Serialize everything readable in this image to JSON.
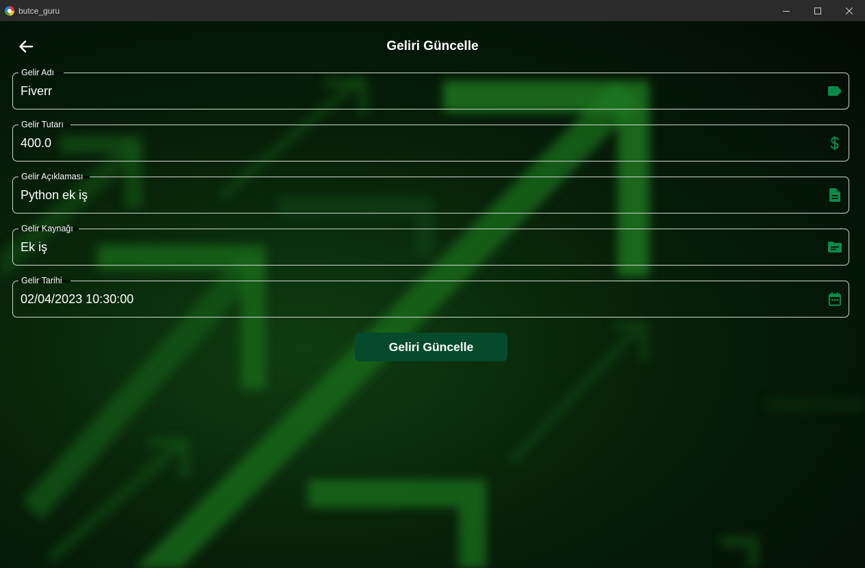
{
  "window": {
    "title": "butce_guru",
    "controls": [
      "minimize-icon",
      "maximize-icon",
      "close-icon"
    ]
  },
  "header": {
    "back_icon": "arrow-left-icon",
    "title": "Geliri Güncelle"
  },
  "form": {
    "fields": [
      {
        "label": "Gelir Adı",
        "value": "Fiverr",
        "icon": "label-tag-icon"
      },
      {
        "label": "Gelir Tutarı",
        "value": "400.0",
        "icon": "dollar-icon"
      },
      {
        "label": "Gelir Açıklaması",
        "value": "Python ek iş",
        "icon": "document-icon"
      },
      {
        "label": "Gelir Kaynağı",
        "value": "Ek iş",
        "icon": "folder-icon"
      },
      {
        "label": "Gelir Tarihi",
        "value": "02/04/2023 10:30:00",
        "icon": "calendar-icon"
      }
    ],
    "submit_label": "Geliri Güncelle"
  },
  "colors": {
    "accent": "#0a8a4a",
    "button": "#064a2c",
    "border": "#cfd8cf",
    "background": "#020a03"
  }
}
